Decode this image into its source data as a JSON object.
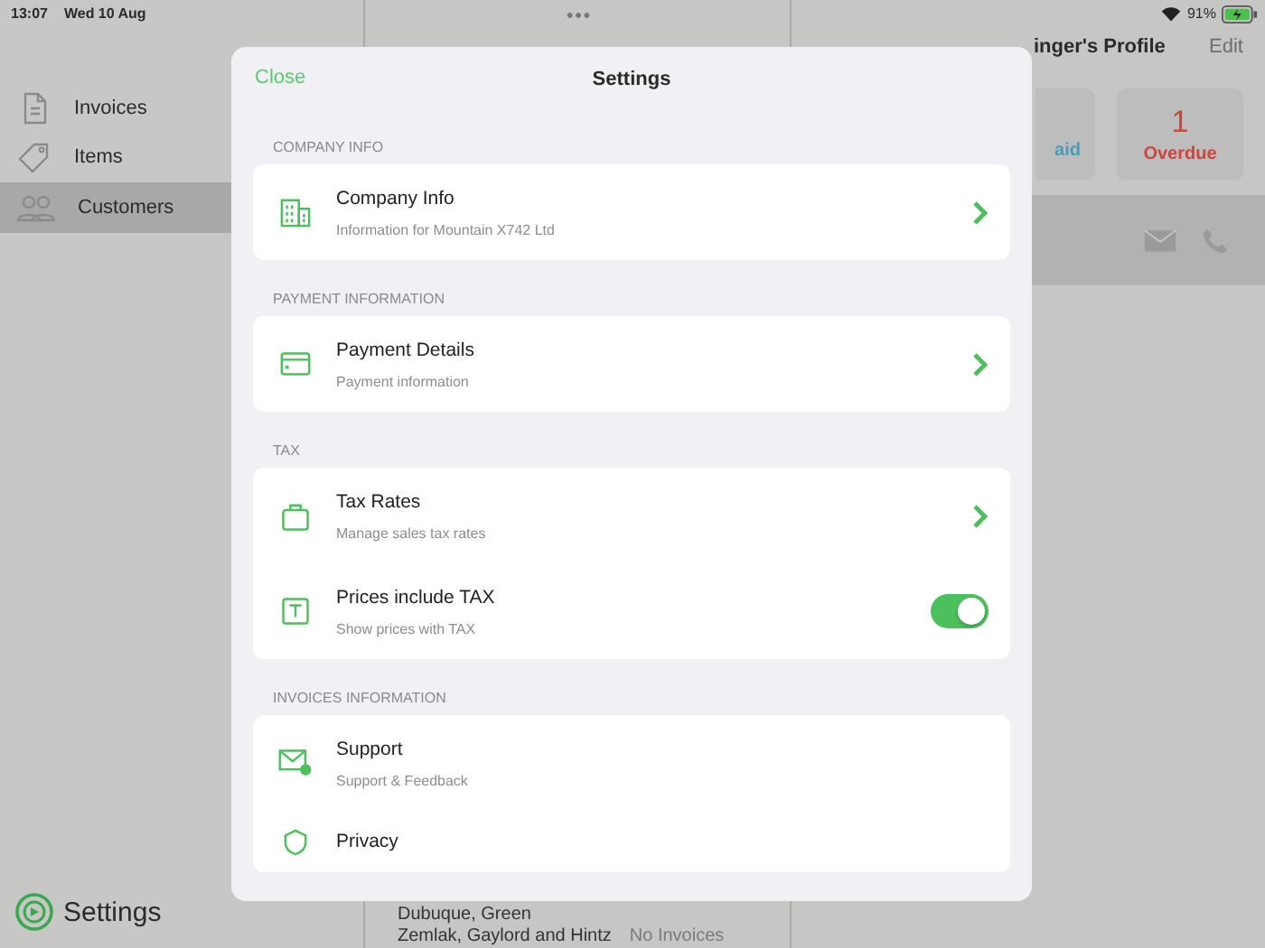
{
  "status_bar": {
    "time": "13:07",
    "date": "Wed 10 Aug",
    "battery": "91%"
  },
  "sidebar": {
    "items": [
      {
        "label": "Invoices",
        "selected": false
      },
      {
        "label": "Items",
        "selected": false
      },
      {
        "label": "Customers",
        "selected": true
      }
    ],
    "settings_button": "Settings"
  },
  "customer_list": {
    "rows": [
      {
        "name": "Dubuque, Green"
      },
      {
        "name": "Zemlak, Gaylord and Hintz",
        "status": "No Invoices"
      }
    ]
  },
  "profile": {
    "title": "inger's Profile",
    "edit": "Edit",
    "stats": [
      {
        "label": "aid",
        "color": "#4a9ab8"
      },
      {
        "value": "1",
        "label": "Overdue",
        "color": "#d0443a"
      }
    ]
  },
  "modal": {
    "close": "Close",
    "title": "Settings",
    "sections": [
      {
        "header": "COMPANY INFO",
        "rows": [
          {
            "kind": "link",
            "title": "Company Info",
            "subtitle": "Information for Mountain X742 Ltd"
          }
        ]
      },
      {
        "header": "PAYMENT INFORMATION",
        "rows": [
          {
            "kind": "link",
            "title": "Payment Details",
            "subtitle": "Payment information"
          }
        ]
      },
      {
        "header": "TAX",
        "rows": [
          {
            "kind": "link",
            "title": "Tax Rates",
            "subtitle": "Manage sales tax rates"
          },
          {
            "kind": "toggle",
            "title": "Prices include TAX",
            "subtitle": "Show prices with TAX",
            "on": true
          }
        ]
      },
      {
        "header": "INVOICES INFORMATION",
        "rows": [
          {
            "kind": "plain",
            "title": "Support",
            "subtitle": "Support & Feedback"
          },
          {
            "kind": "plain",
            "title": "Privacy"
          }
        ]
      }
    ]
  }
}
